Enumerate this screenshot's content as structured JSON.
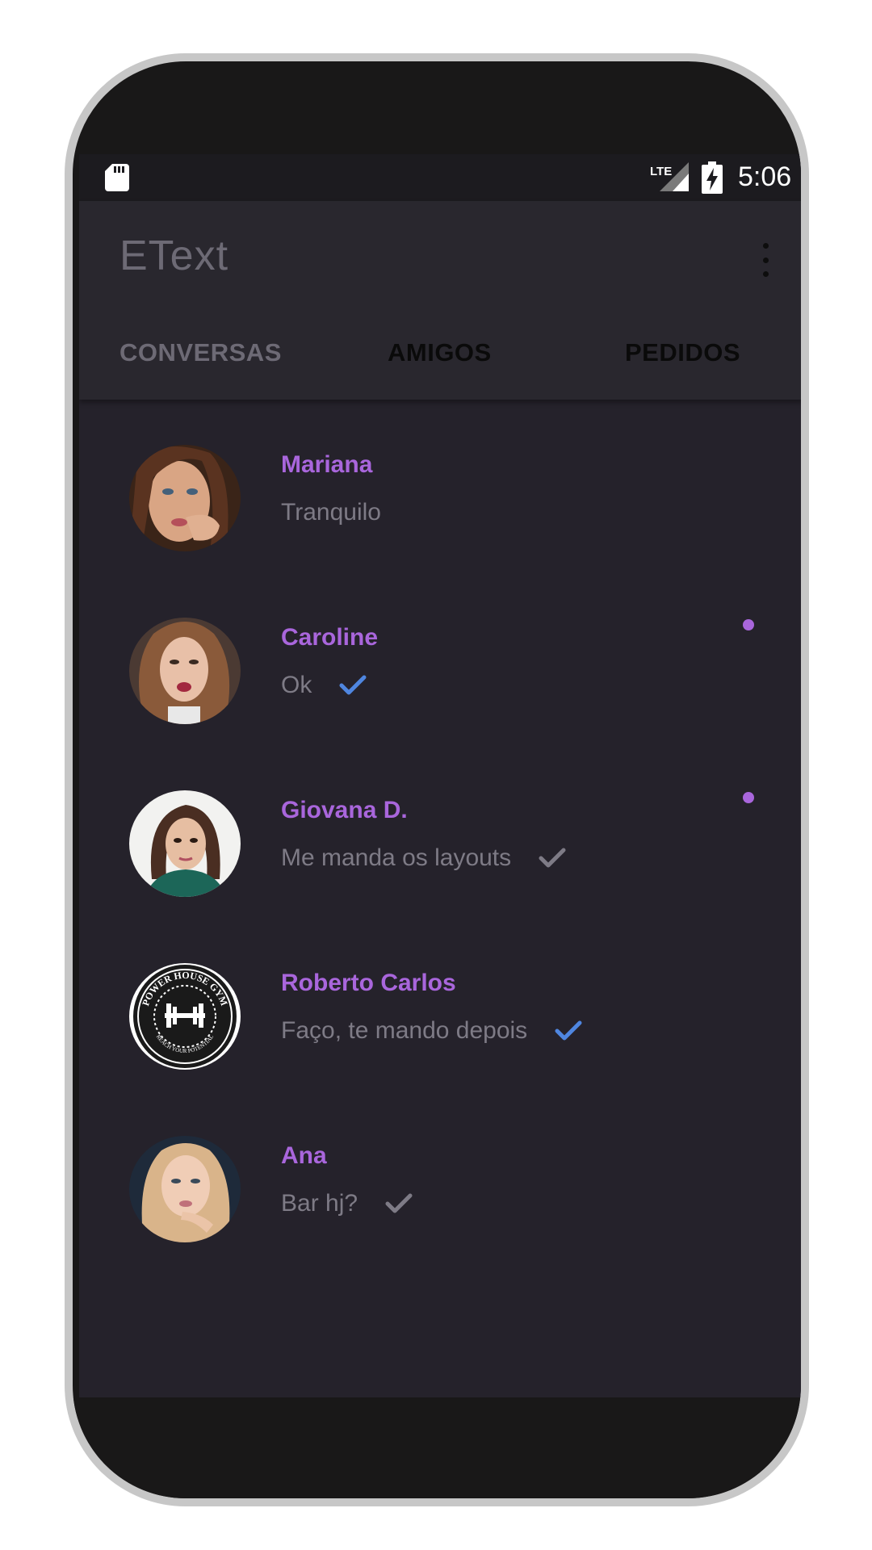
{
  "statusbar": {
    "network": "LTE",
    "time": "5:06"
  },
  "appbar": {
    "title": "EText",
    "menu_icon": "more-vertical-icon"
  },
  "tabs": [
    {
      "label": "CONVERSAS",
      "active": true
    },
    {
      "label": "AMIGOS",
      "active": false
    },
    {
      "label": "PEDIDOS",
      "active": false
    }
  ],
  "conversations": [
    {
      "name": "Mariana",
      "message": "Tranquilo",
      "status": "none",
      "unread": false
    },
    {
      "name": "Caroline",
      "message": "Ok",
      "status": "read",
      "unread": true
    },
    {
      "name": "Giovana D.",
      "message": "Me manda os layouts",
      "status": "sent",
      "unread": true
    },
    {
      "name": "Roberto Carlos",
      "message": "Faço, te mando depois",
      "status": "read",
      "unread": false
    },
    {
      "name": "Ana",
      "message": "Bar hj?",
      "status": "sent",
      "unread": false
    }
  ],
  "avatar_logo": {
    "top_text": "POWER HOUSE GYM",
    "bottom_text": "REACH YOUR POTENTIAL"
  },
  "colors": {
    "accent": "#a966dc",
    "read_check": "#4f86e0",
    "sent_check": "#7e7b86",
    "background": "#25222b",
    "appbar": "#29272e"
  }
}
